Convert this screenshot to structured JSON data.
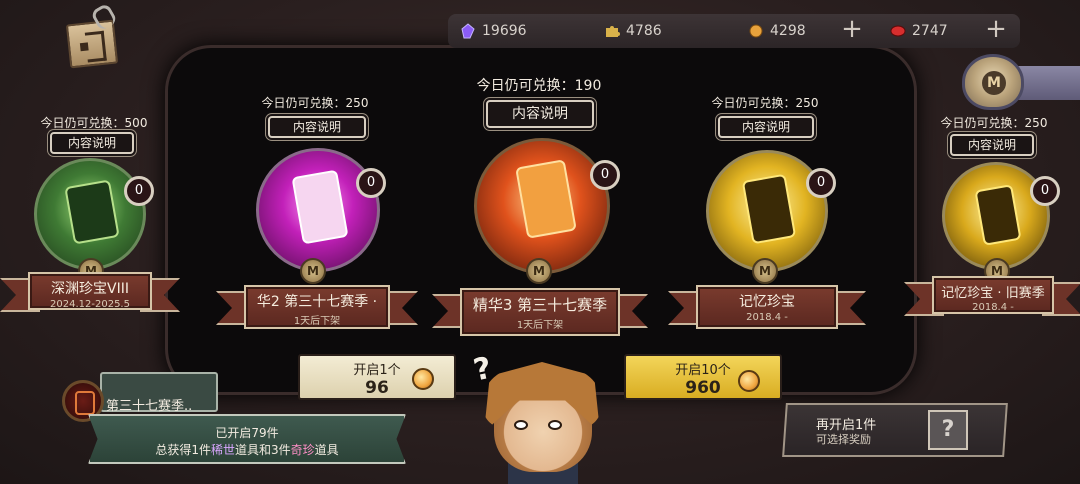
{
  "currency": [
    {
      "id": "purple-gem",
      "value": "19696",
      "color": "#8b5cf6"
    },
    {
      "id": "puzzle",
      "value": "4786",
      "color": "#d9b24a"
    },
    {
      "id": "clue",
      "value": "4298",
      "color": "#e8a23c"
    },
    {
      "id": "red-echo",
      "value": "2747",
      "color": "#d62e2e"
    }
  ],
  "plus": "+",
  "exit_icon": "exit-door-icon",
  "badge_letter": "M",
  "items": [
    {
      "quota": "今日仍可兑换：500",
      "desc": "内容说明",
      "count": "0",
      "name": "深渊珍宝VIII",
      "sub": "2024.12-2025.5"
    },
    {
      "quota": "今日仍可兑换：250",
      "desc": "内容说明",
      "count": "0",
      "name": "华2    第三十七赛季 ·",
      "sub": "1天后下架"
    },
    {
      "quota": "今日仍可兑换：190",
      "desc": "内容说明",
      "count": "0",
      "name": "精华3    第三十七赛季",
      "sub": "1天后下架"
    },
    {
      "quota": "今日仍可兑换：250",
      "desc": "内容说明",
      "count": "0",
      "name": "记忆珍宝",
      "sub": "2018.4 -"
    },
    {
      "quota": "今日仍可兑换：250",
      "desc": "内容说明",
      "count": "0",
      "name": "记忆珍宝 · 旧赛季",
      "sub": "2018.4 -"
    }
  ],
  "open1": {
    "label": "开启1个",
    "cost": "96"
  },
  "open10": {
    "label": "开启10个",
    "cost": "960"
  },
  "season": {
    "title": "第三十七赛季..",
    "opened": "已开启79件",
    "summary_a": "总获得",
    "summary_b": "1件",
    "summary_c": "稀世",
    "summary_d": "道具和",
    "summary_e": "3件",
    "summary_f": "奇珍",
    "summary_g": "道具"
  },
  "reward": {
    "line1": "再开启1件",
    "line2": "可选择奖励",
    "slot": "?"
  },
  "character_mark": "?"
}
